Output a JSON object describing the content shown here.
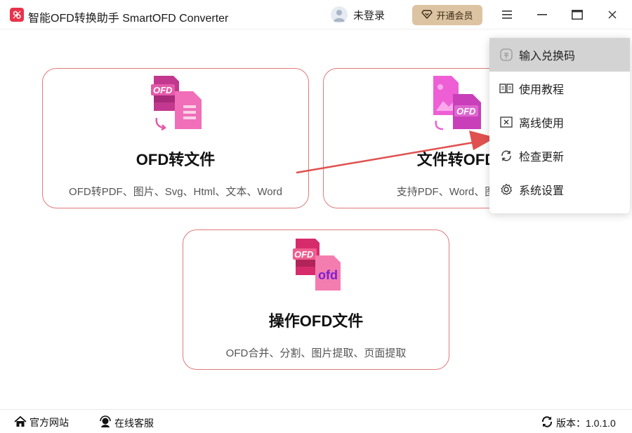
{
  "app": {
    "title": "智能OFD转换助手 SmartOFD Converter",
    "logo_icon": "app-logo-icon",
    "brand_color": "#e8334a"
  },
  "header": {
    "login_label": "未登录",
    "vip_label": "开通会员",
    "vip_color": "#dcc3a2"
  },
  "cards": [
    {
      "title": "OFD转文件",
      "desc": "OFD转PDF、图片、Svg、Html、文本、Word",
      "icon": "ofd-to-file-icon"
    },
    {
      "title": "文件转OFD",
      "desc": "支持PDF、Word、图片、",
      "icon": "file-to-ofd-icon"
    },
    {
      "title": "操作OFD文件",
      "desc": "OFD合并、分割、图片提取、页面提取",
      "icon": "ofd-operate-icon"
    }
  ],
  "menu": {
    "items": [
      {
        "label": "输入兑换码",
        "icon": "redeem-code-icon"
      },
      {
        "label": "使用教程",
        "icon": "book-icon"
      },
      {
        "label": "离线使用",
        "icon": "offline-icon"
      },
      {
        "label": "检查更新",
        "icon": "refresh-icon"
      },
      {
        "label": "系统设置",
        "icon": "gear-icon"
      }
    ]
  },
  "footer": {
    "website_label": "官方网站",
    "support_label": "在线客服",
    "version_label": "版本：1.0.1.0"
  },
  "card_border_color": "#e07a7a",
  "arrow_color": "#e0504f"
}
